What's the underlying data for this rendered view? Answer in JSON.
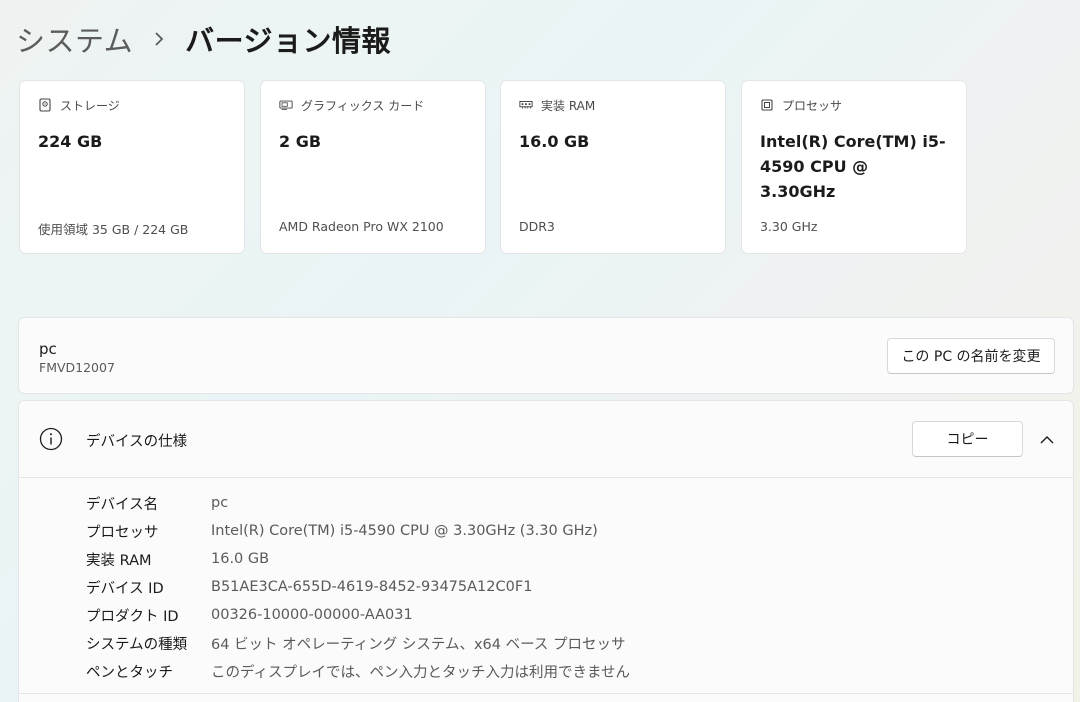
{
  "breadcrumb": {
    "parent": "システム",
    "separator": "›",
    "current": "バージョン情報"
  },
  "cards": [
    {
      "icon": "storage-icon",
      "label": "ストレージ",
      "value": "224 GB",
      "sub": "使用領域 35 GB / 224 GB"
    },
    {
      "icon": "graphics-card-icon",
      "label": "グラフィックス カード",
      "value": "2 GB",
      "sub": "AMD Radeon Pro WX 2100"
    },
    {
      "icon": "memory-icon",
      "label": "実装 RAM",
      "value": "16.0 GB",
      "sub": "DDR3"
    },
    {
      "icon": "processor-icon",
      "label": "プロセッサ",
      "value": "Intel(R) Core(TM) i5-4590 CPU @ 3.30GHz",
      "sub": "3.30 GHz"
    }
  ],
  "pc": {
    "name": "pc",
    "model": "FMVD12007",
    "rename_label": "この PC の名前を変更"
  },
  "device_specs": {
    "title": "デバイスの仕様",
    "copy_label": "コピー",
    "rows": [
      {
        "label": "デバイス名",
        "value": "pc"
      },
      {
        "label": "プロセッサ",
        "value": "Intel(R) Core(TM) i5-4590 CPU @ 3.30GHz (3.30 GHz)"
      },
      {
        "label": "実装 RAM",
        "value": "16.0 GB"
      },
      {
        "label": "デバイス ID",
        "value": "B51AE3CA-655D-4619-8452-93475A12C0F1"
      },
      {
        "label": "プロダクト ID",
        "value": "00326-10000-00000-AA031"
      },
      {
        "label": "システムの種類",
        "value": "64 ビット オペレーティング システム、x64 ベース プロセッサ"
      },
      {
        "label": "ペンとタッチ",
        "value": "このディスプレイでは、ペン入力とタッチ入力は利用できません"
      }
    ]
  }
}
